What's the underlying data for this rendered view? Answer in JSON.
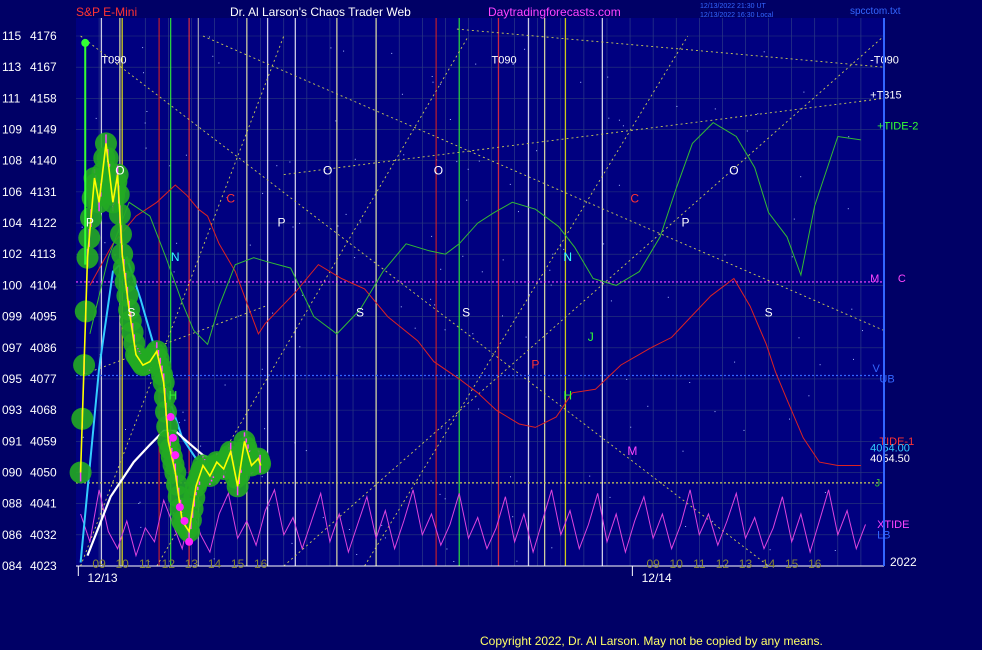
{
  "header": {
    "symbol": "S&P E-Mini",
    "title": "Dr. Al Larson's Chaos Trader Web",
    "site": "Daytradingforecasts.com",
    "stamp_line1": "12/13/2022 21:30 UT",
    "stamp_line2": "12/13/2022 16:30 Local",
    "file": "spcctom.txt"
  },
  "copyright": "Copyright 2022, Dr. Al Larson. May not be copied by any means.",
  "colors": {
    "background": "#000066",
    "plot_bg": "#000080",
    "price": "#ffff00",
    "price_bars": "#ff44ff",
    "green_dots": "#22aa22",
    "cyan_ma": "#33ccff",
    "white_ma": "#ffffff",
    "tide1": "#dd2222",
    "tide2": "#33bb33",
    "xtide": "#dd44dd"
  },
  "chart_data": {
    "type": "line",
    "title": "S&P E-Mini",
    "y_labels": [
      {
        "code": "115",
        "price": "4176"
      },
      {
        "code": "113",
        "price": "4167"
      },
      {
        "code": "111",
        "price": "4158"
      },
      {
        "code": "109",
        "price": "4149"
      },
      {
        "code": "108",
        "price": "4140"
      },
      {
        "code": "106",
        "price": "4131"
      },
      {
        "code": "104",
        "price": "4122"
      },
      {
        "code": "102",
        "price": "4113"
      },
      {
        "code": "100",
        "price": "4104"
      },
      {
        "code": "099",
        "price": "4095"
      },
      {
        "code": "097",
        "price": "4086"
      },
      {
        "code": "095",
        "price": "4077"
      },
      {
        "code": "093",
        "price": "4068"
      },
      {
        "code": "091",
        "price": "4059"
      },
      {
        "code": "090",
        "price": "4050"
      },
      {
        "code": "088",
        "price": "4041"
      },
      {
        "code": "086",
        "price": "4032"
      },
      {
        "code": "084",
        "price": "4023"
      }
    ],
    "ylim": [
      4023,
      4176
    ],
    "x_tick_labels": [
      "09",
      "10",
      "11",
      "12",
      "13",
      "14",
      "15",
      "16",
      "09",
      "10",
      "11",
      "12",
      "13",
      "14",
      "15",
      "16"
    ],
    "x_tick_hours": [
      9,
      10,
      11,
      12,
      13,
      14,
      15,
      16,
      33,
      34,
      35,
      36,
      37,
      38,
      39,
      40
    ],
    "date_labels": [
      {
        "text": "12/13",
        "hour": 8.5
      },
      {
        "text": "12/14",
        "hour": 32.5
      }
    ],
    "xlim": [
      8,
      43
    ],
    "year": "2022",
    "price_series": {
      "name": "ES",
      "hours": [
        8.2,
        8.5,
        8.8,
        9.0,
        9.3,
        9.6,
        9.8,
        10.0,
        10.3,
        10.6,
        10.9,
        11.2,
        11.5,
        11.8,
        12.0,
        12.3,
        12.6,
        12.9,
        13.2,
        13.5,
        13.8,
        14.1,
        14.4,
        14.7,
        15.0,
        15.3,
        15.6,
        15.9,
        16.0
      ],
      "values": [
        4050,
        4112,
        4135,
        4128,
        4145,
        4128,
        4136,
        4113,
        4097,
        4084,
        4081,
        4082,
        4085,
        4076,
        4059,
        4050,
        4036,
        4033,
        4046,
        4052,
        4049,
        4053,
        4051,
        4056,
        4046,
        4059,
        4052,
        4054,
        4052
      ]
    },
    "series": [
      {
        "name": "TIDE-1",
        "hours": [
          8.6,
          9.6,
          10.6,
          11.5,
          12.3,
          12.8,
          13.3,
          13.7,
          14.2,
          14.9,
          15.4,
          15.9,
          16.2,
          17.5,
          18.5,
          19.5,
          20.5,
          21.5,
          22.8,
          23.5,
          24.6,
          25.4,
          26.2,
          27.2,
          27.9,
          28.8,
          29.5,
          30.5,
          31.6,
          32.9,
          33.8,
          34.5,
          35.5,
          36.5,
          37.2,
          37.9,
          38.3,
          38.8,
          39.5,
          40.2,
          41.0,
          42.0
        ],
        "values": [
          4104,
          4116,
          4124,
          4128,
          4133,
          4130,
          4126,
          4124,
          4116,
          4108,
          4099,
          4090,
          4093,
          4102,
          4110,
          4106,
          4103,
          4095,
          4088,
          4082,
          4077,
          4073,
          4068,
          4064,
          4063,
          4066,
          4073,
          4074,
          4081,
          4086,
          4089,
          4094,
          4101,
          4106,
          4098,
          4087,
          4079,
          4071,
          4060,
          4053,
          4052,
          4052
        ]
      },
      {
        "name": "TIDE-2",
        "hours": [
          8.6,
          9.4,
          10.3,
          11.2,
          11.9,
          12.6,
          13.1,
          13.7,
          14.2,
          14.9,
          15.7,
          16.2,
          17.3,
          18.3,
          19.3,
          20.3,
          21.3,
          22.3,
          23.3,
          24.0,
          24.6,
          25.4,
          26.1,
          26.9,
          27.9,
          28.9,
          29.6,
          30.4,
          31.4,
          32.4,
          33.3,
          34.0,
          34.7,
          35.6,
          36.6,
          37.4,
          38.0,
          38.8,
          39.4,
          40.0,
          41.0,
          42.0
        ],
        "values": [
          4090,
          4112,
          4128,
          4124,
          4112,
          4099,
          4091,
          4087,
          4098,
          4110,
          4112,
          4111,
          4109,
          4095,
          4090,
          4097,
          4108,
          4116,
          4114,
          4113,
          4116,
          4122,
          4125,
          4128,
          4126,
          4121,
          4115,
          4106,
          4104,
          4108,
          4118,
          4132,
          4145,
          4151,
          4147,
          4138,
          4125,
          4118,
          4107,
          4127,
          4147,
          4146
        ]
      },
      {
        "name": "XTIDE",
        "hours": [
          8.2,
          8.6,
          9.0,
          9.4,
          9.8,
          10.2,
          10.6,
          11.0,
          11.4,
          11.8,
          12.2,
          12.6,
          13.0,
          13.4,
          13.8,
          14.2,
          14.6,
          15.0,
          15.4,
          15.8,
          16.2,
          16.6,
          17.0,
          17.4,
          17.8,
          18.2,
          18.6,
          19.0,
          19.4,
          19.8,
          20.2,
          20.6,
          21.0,
          21.4,
          21.8,
          22.2,
          22.6,
          23.0,
          23.4,
          23.8,
          24.2,
          24.6,
          25.0,
          25.4,
          25.8,
          26.2,
          26.6,
          27.0,
          27.4,
          27.8,
          28.2,
          28.6,
          29.0,
          29.4,
          29.8,
          30.2,
          30.6,
          31.0,
          31.4,
          31.8,
          32.2,
          32.6,
          33.0,
          33.4,
          33.8,
          34.2,
          34.6,
          35.0,
          35.4,
          35.8,
          36.2,
          36.6,
          37.0,
          37.4,
          37.8,
          38.2,
          38.6,
          39.0,
          39.4,
          39.8,
          40.2,
          40.6,
          41.0,
          41.4,
          41.8,
          42.2
        ],
        "values": [
          4038,
          4030,
          4045,
          4033,
          4028,
          4036,
          4026,
          4034,
          4030,
          4042,
          4035,
          4028,
          4040,
          4032,
          4027,
          4038,
          4044,
          4031,
          4036,
          4029,
          4039,
          4045,
          4032,
          4037,
          4028,
          4036,
          4044,
          4030,
          4038,
          4027,
          4035,
          4043,
          4031,
          4039,
          4028,
          4036,
          4045,
          4032,
          4038,
          4029,
          4035,
          4044,
          4031,
          4037,
          4028,
          4034,
          4043,
          4030,
          4038,
          4027,
          4036,
          4045,
          4032,
          4039,
          4028,
          4035,
          4044,
          4030,
          4038,
          4027,
          4036,
          4043,
          4031,
          4038,
          4028,
          4035,
          4045,
          4032,
          4038,
          4029,
          4036,
          4044,
          4031,
          4037,
          4028,
          4034,
          4043,
          4030,
          4038,
          4027,
          4036,
          4045,
          4032,
          4039,
          4028,
          4035
        ]
      },
      {
        "name": "Cyan MA",
        "hours": [
          8.2,
          9.0,
          9.6,
          10.2,
          10.8,
          11.4,
          12.0,
          12.6,
          13.2,
          14.0,
          15.0,
          16.0
        ],
        "values": [
          4024,
          4080,
          4108,
          4112,
          4100,
          4086,
          4072,
          4060,
          4054,
          4052,
          4050,
          4050
        ]
      },
      {
        "name": "White MA",
        "hours": [
          8.5,
          9.5,
          10.5,
          11.2,
          11.8,
          12.3,
          12.8,
          13.5,
          14.5,
          15.5,
          16.0
        ],
        "values": [
          4026,
          4043,
          4053,
          4058,
          4062,
          4062,
          4059,
          4055,
          4052,
          4051,
          4051
        ]
      }
    ],
    "hlines": [
      {
        "name": "M",
        "value": 4105
      },
      {
        "name": "J",
        "value": 4047
      },
      {
        "name": "V",
        "value": 4078
      }
    ],
    "vertical_events": [
      {
        "hour": 9.1,
        "color": "#ffffff"
      },
      {
        "hour": 9.9,
        "color": "#ffffaa"
      },
      {
        "hour": 10.0,
        "color": "#ffff00"
      },
      {
        "hour": 11.6,
        "color": "#dd2222"
      },
      {
        "hour": 12.1,
        "color": "#33ff33"
      },
      {
        "hour": 12.9,
        "color": "#ff3333"
      },
      {
        "hour": 13.3,
        "color": "#bbbbbb"
      },
      {
        "hour": 15.4,
        "color": "#ffffaa"
      },
      {
        "hour": 16.3,
        "color": "#ffffff"
      },
      {
        "hour": 17.5,
        "color": "#ffffff"
      },
      {
        "hour": 19.3,
        "color": "#ffffaa"
      },
      {
        "hour": 21.0,
        "color": "#ffffaa"
      },
      {
        "hour": 23.6,
        "color": "#dd2222"
      },
      {
        "hour": 24.6,
        "color": "#33ff33"
      },
      {
        "hour": 26.3,
        "color": "#ff3333"
      },
      {
        "hour": 27.6,
        "color": "#ffffff"
      },
      {
        "hour": 28.3,
        "color": "#ffffaa"
      },
      {
        "hour": 29.2,
        "color": "#ffff00"
      },
      {
        "hour": 30.8,
        "color": "#ffffff"
      }
    ],
    "letters": [
      {
        "text": "P",
        "hour": 8.6,
        "value": 4121,
        "color": "#ffffff"
      },
      {
        "text": "O",
        "hour": 9.9,
        "value": 4136,
        "color": "#ffffff"
      },
      {
        "text": "S",
        "hour": 10.4,
        "value": 4095,
        "color": "#ffffff"
      },
      {
        "text": "N",
        "hour": 12.3,
        "value": 4111,
        "color": "#33ffff"
      },
      {
        "text": "H",
        "hour": 12.2,
        "value": 4071,
        "color": "#33ff33"
      },
      {
        "text": "C",
        "hour": 14.7,
        "value": 4128,
        "color": "#ff3333"
      },
      {
        "text": "P",
        "hour": 16.9,
        "value": 4121,
        "color": "#ffffff"
      },
      {
        "text": "O",
        "hour": 18.9,
        "value": 4136,
        "color": "#ffffff"
      },
      {
        "text": "S",
        "hour": 20.3,
        "value": 4095,
        "color": "#ffffff"
      },
      {
        "text": "O",
        "hour": 23.7,
        "value": 4136,
        "color": "#ffffff"
      },
      {
        "text": "S",
        "hour": 24.9,
        "value": 4095,
        "color": "#ffffff"
      },
      {
        "text": "N",
        "hour": 29.3,
        "value": 4111,
        "color": "#33ffff"
      },
      {
        "text": "H",
        "hour": 29.3,
        "value": 4071,
        "color": "#33ff33"
      },
      {
        "text": "J",
        "hour": 30.3,
        "value": 4088,
        "color": "#33ff33"
      },
      {
        "text": "P",
        "hour": 27.9,
        "value": 4080,
        "color": "#ff3333"
      },
      {
        "text": "M",
        "hour": 32.1,
        "value": 4055,
        "color": "#ff44ff"
      },
      {
        "text": "C",
        "hour": 32.2,
        "value": 4128,
        "color": "#ff3333"
      },
      {
        "text": "P",
        "hour": 34.4,
        "value": 4121,
        "color": "#ffffff"
      },
      {
        "text": "O",
        "hour": 36.5,
        "value": 4136,
        "color": "#ffffff"
      },
      {
        "text": "S",
        "hour": 38.0,
        "value": 4095,
        "color": "#ffffff"
      }
    ],
    "diagonal_lines": [
      {
        "from": [
          8.2,
          4078
        ],
        "to": [
          16.2,
          4098
        ]
      },
      {
        "from": [
          17.0,
          4136
        ],
        "to": [
          43.0,
          4158
        ]
      },
      {
        "from": [
          24.5,
          4178
        ],
        "to": [
          43.0,
          4167
        ]
      },
      {
        "from": [
          8.2,
          4176
        ],
        "to": [
          38.0,
          4023
        ]
      },
      {
        "from": [
          13.5,
          4176
        ],
        "to": [
          43.0,
          4091
        ]
      },
      {
        "from": [
          8.2,
          4023
        ],
        "to": [
          17.0,
          4176
        ]
      },
      {
        "from": [
          17.0,
          4023
        ],
        "to": [
          43.0,
          4176
        ]
      },
      {
        "from": [
          20.5,
          4023
        ],
        "to": [
          34.5,
          4176
        ]
      },
      {
        "from": [
          11.5,
          4023
        ],
        "to": [
          25.0,
          4176
        ]
      }
    ],
    "annotations": [
      {
        "text": "T090",
        "hour": 9.1,
        "value": 4168,
        "color": "#ffffff"
      },
      {
        "text": "T090",
        "hour": 26.0,
        "value": 4168,
        "color": "#ffffff"
      },
      {
        "text": "-T090",
        "hour": 42.4,
        "value": 4168,
        "color": "#ffffff"
      },
      {
        "text": "+T315",
        "hour": 42.4,
        "value": 4158,
        "color": "#ffffff"
      },
      {
        "text": "+TIDE-2",
        "hour": 42.7,
        "value": 4149,
        "color": "#33ff33"
      },
      {
        "text": "M",
        "hour": 42.4,
        "value": 4105,
        "color": "#ff44ff"
      },
      {
        "text": "C",
        "hour": 43.6,
        "value": 4105,
        "color": "#ff44ff"
      },
      {
        "text": "V",
        "hour": 42.5,
        "value": 4079,
        "color": "#3366ff"
      },
      {
        "text": "UB",
        "hour": 42.8,
        "value": 4076,
        "color": "#3366ff"
      },
      {
        "text": "TIDE-1",
        "hour": 42.8,
        "value": 4058,
        "color": "#ff3333"
      },
      {
        "text": "4054.00",
        "hour": 42.4,
        "value": 4056,
        "color": "#33ccff"
      },
      {
        "text": "4054.50",
        "hour": 42.4,
        "value": 4053,
        "color": "#ffffff"
      },
      {
        "text": "J",
        "hour": 42.6,
        "value": 4046,
        "color": "#33bb33"
      },
      {
        "text": "XTIDE",
        "hour": 42.7,
        "value": 4034,
        "color": "#ff44ff"
      },
      {
        "text": "LB",
        "hour": 42.7,
        "value": 4031,
        "color": "#3366ff"
      }
    ]
  }
}
